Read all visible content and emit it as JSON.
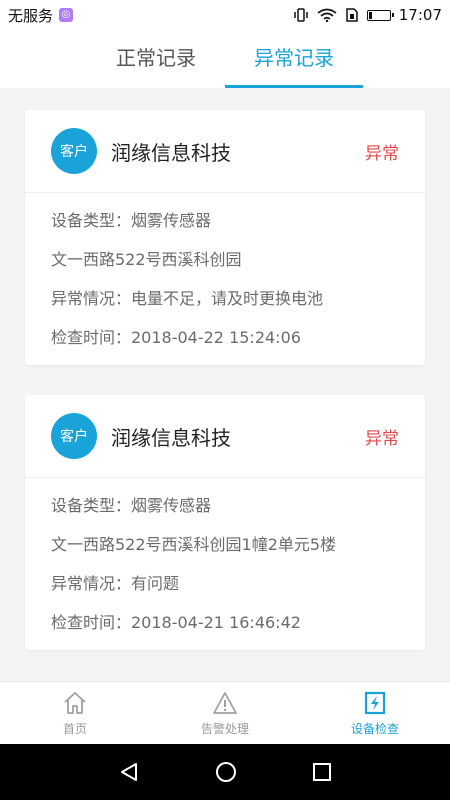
{
  "status_bar": {
    "carrier": "无服务",
    "time": "17:07"
  },
  "tabs": [
    {
      "label": "正常记录"
    },
    {
      "label": "异常记录"
    }
  ],
  "records": [
    {
      "avatar_label": "客户",
      "company": "润缘信息科技",
      "status": "异常",
      "device_type": "设备类型：烟雾传感器",
      "address": "文一西路522号西溪科创园",
      "exception": "异常情况：电量不足，请及时更换电池",
      "check_time": "检查时间：2018-04-22 15:24:06"
    },
    {
      "avatar_label": "客户",
      "company": "润缘信息科技",
      "status": "异常",
      "device_type": "设备类型：烟雾传感器",
      "address": "文一西路522号西溪科创园1幢2单元5楼",
      "exception": "异常情况：有问题",
      "check_time": "检查时间：2018-04-21 16:46:42"
    }
  ],
  "bottom_nav": [
    {
      "label": "首页",
      "icon": "home-icon"
    },
    {
      "label": "告警处理",
      "icon": "warning-icon"
    },
    {
      "label": "设备检查",
      "icon": "device-check-icon"
    }
  ],
  "colors": {
    "accent": "#1aa3d9",
    "alert": "#e14b4b"
  }
}
